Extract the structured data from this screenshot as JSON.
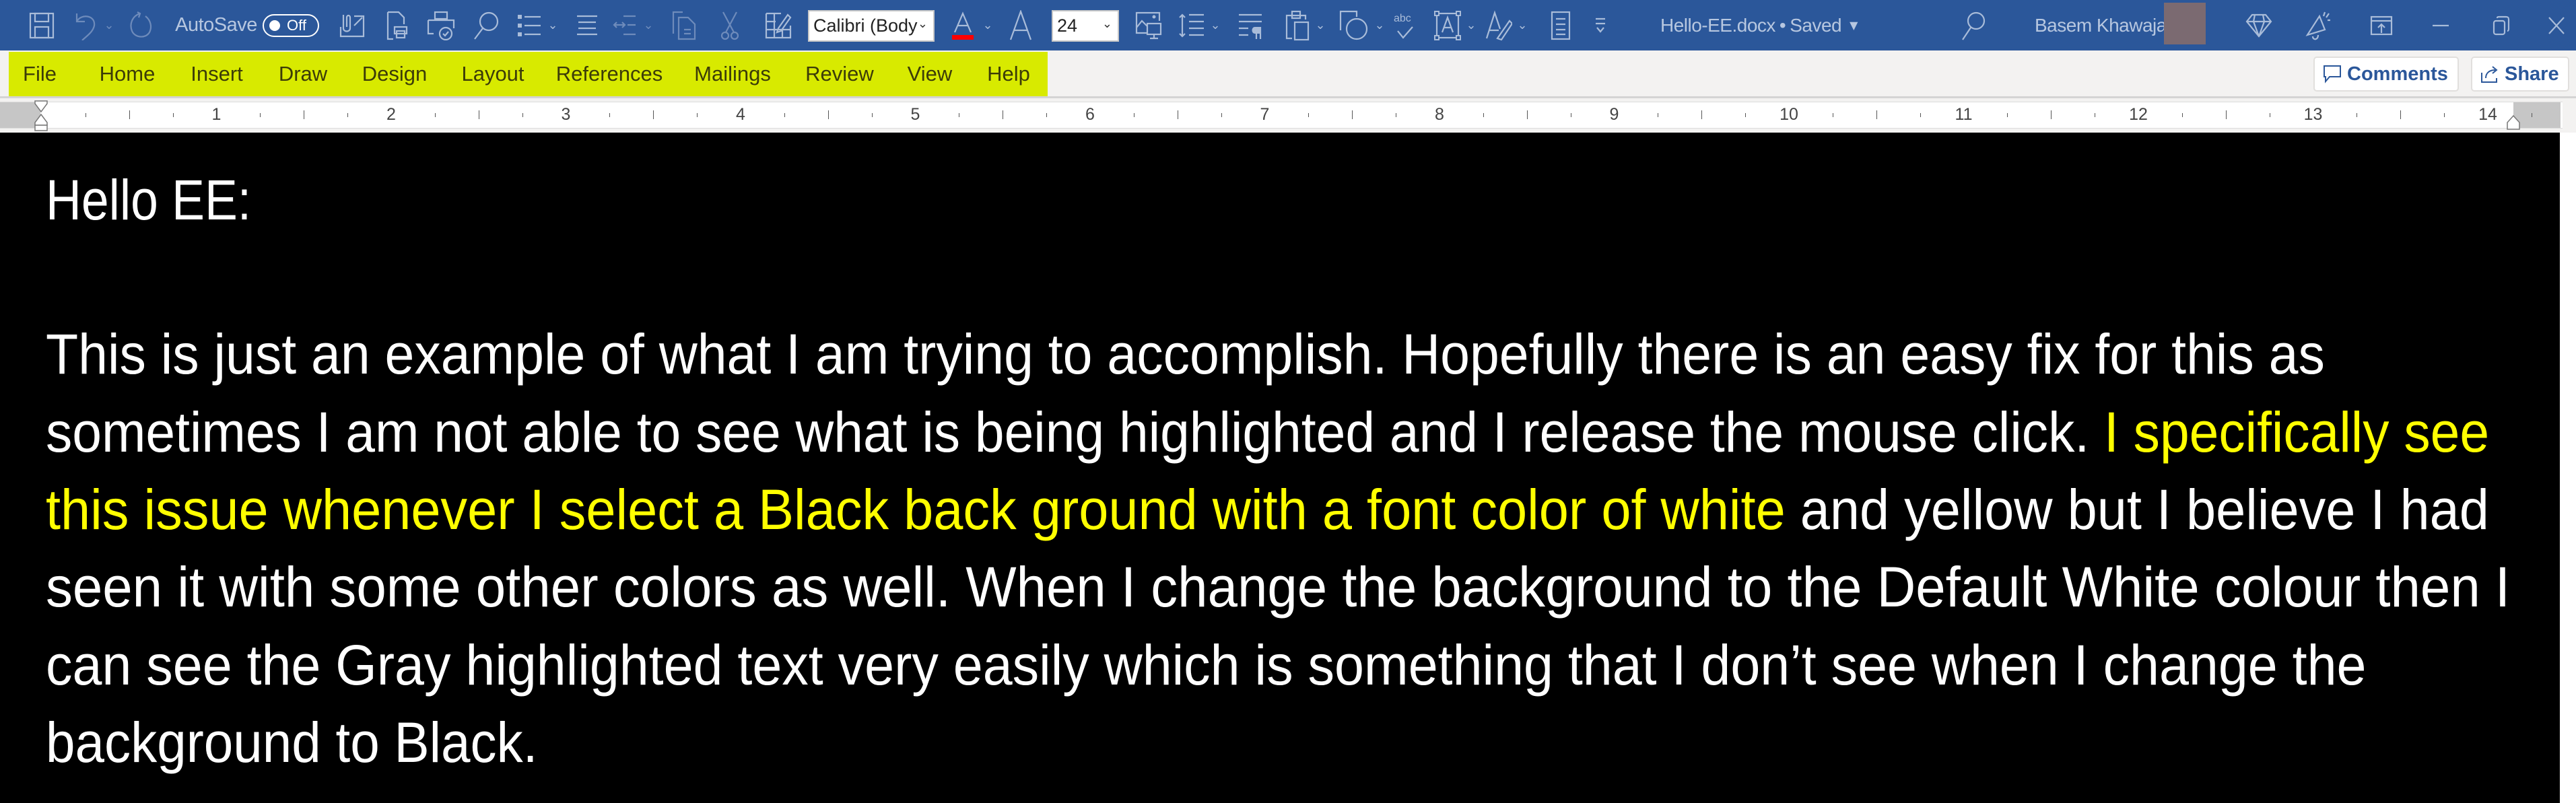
{
  "titlebar": {
    "quick_access": [
      {
        "name": "save-icon"
      },
      {
        "name": "undo-icon"
      },
      {
        "name": "redo-icon"
      }
    ],
    "autosave_label": "AutoSave",
    "autosave_state": "Off",
    "font_name": "Calibri (Body",
    "font_size": "24",
    "font_color_accent": "#ff0000",
    "document_title": "Hello-EE.docx",
    "separator": "•",
    "save_status": "Saved",
    "title_dropdown": "▼",
    "user_name": "Basem Khawaja",
    "chevron": "⌄",
    "colors": {
      "titlebar_bg": "#2b579a",
      "tab_highlight": "#d8ea00",
      "avatar": "#7b6a71"
    }
  },
  "ribbon": {
    "tabs": [
      {
        "label": "File"
      },
      {
        "label": "Home"
      },
      {
        "label": "Insert"
      },
      {
        "label": "Draw"
      },
      {
        "label": "Design"
      },
      {
        "label": "Layout"
      },
      {
        "label": "References"
      },
      {
        "label": "Mailings"
      },
      {
        "label": "Review"
      },
      {
        "label": "View"
      },
      {
        "label": "Help"
      }
    ],
    "comments_label": "Comments",
    "share_label": "Share"
  },
  "ruler": {
    "numbers": [
      "1",
      "2",
      "3",
      "4",
      "5",
      "6",
      "7",
      "8",
      "9",
      "10",
      "11",
      "12",
      "13",
      "14"
    ]
  },
  "document": {
    "background": "#000000",
    "text_color": "#ffffff",
    "highlight_color": "#ffff00",
    "greeting": "Hello EE:",
    "lines": [
      [
        {
          "text": "This is just an example of what I am trying to accomplish. Hopefully there is an easy fix for this as",
          "yellow": false
        }
      ],
      [
        {
          "text": "sometimes I am not able to see what is being highlighted and I release the mouse click. ",
          "yellow": false
        },
        {
          "text": "I specifically see",
          "yellow": true
        }
      ],
      [
        {
          "text": "this issue whenever I select a Black back ground with a font color of white",
          "yellow": true
        },
        {
          "text": " and yellow but I believe I had",
          "yellow": false
        }
      ],
      [
        {
          "text": "seen it with some other colors as well. When I change the background to the Default White colour then I",
          "yellow": false
        }
      ],
      [
        {
          "text": "can see the Gray highlighted text very easily which is something that I don’t see when I change the",
          "yellow": false
        }
      ],
      [
        {
          "text": "background to Black.",
          "yellow": false
        }
      ]
    ]
  }
}
